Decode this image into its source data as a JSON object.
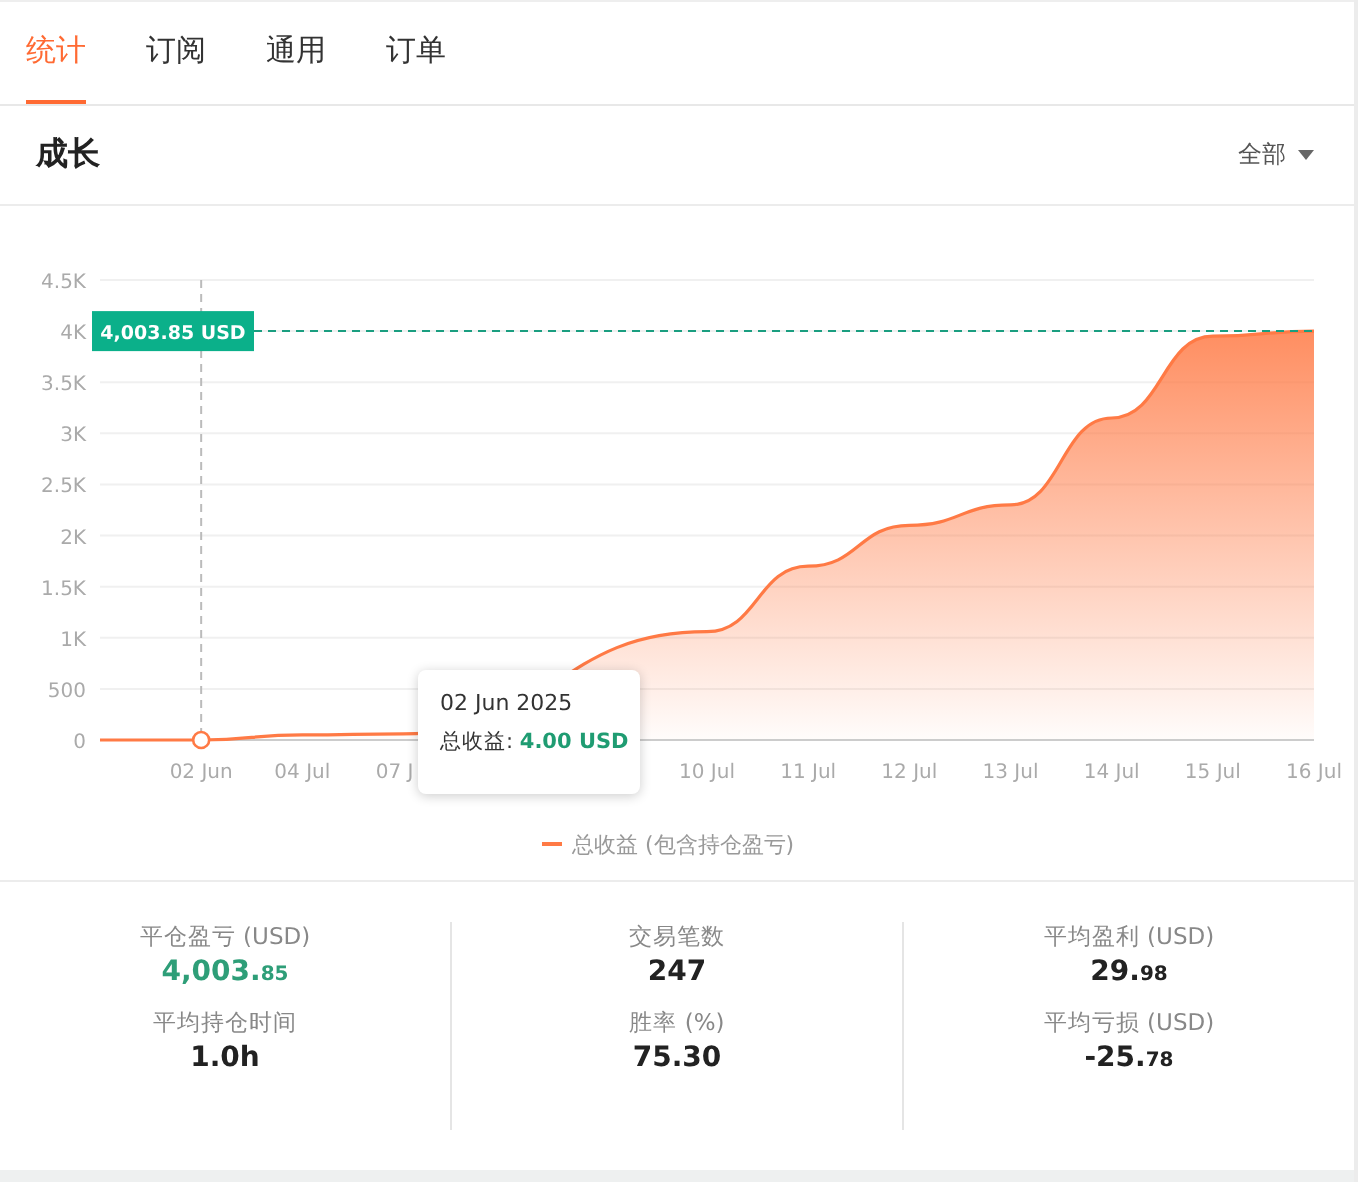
{
  "tabs": [
    {
      "label": "统计",
      "selected": true
    },
    {
      "label": "订阅",
      "selected": false
    },
    {
      "label": "通用",
      "selected": false
    },
    {
      "label": "订单",
      "selected": false
    }
  ],
  "growth": {
    "title": "成长",
    "filter": "全部",
    "tooltip": {
      "date": "02 Jun 2025",
      "text": "总收益: **4.00 USD**"
    },
    "chart_data": {
      "type": "area",
      "categories": [
        null,
        "02 Jun",
        "04 Jul",
        "07 J",
        null,
        null,
        "10 Jul",
        "11 Jul",
        "12 Jul",
        "13 Jul",
        "14 Jul",
        "15 Jul",
        "16 Jul"
      ],
      "ylim": [
        0,
        4500
      ],
      "yticks": [
        {
          "value": 0,
          "label": "0"
        },
        {
          "value": 500,
          "label": "500"
        },
        {
          "value": 1000,
          "label": "1K"
        },
        {
          "value": 1500,
          "label": "1.5K"
        },
        {
          "value": 2000,
          "label": "2K"
        },
        {
          "value": 2500,
          "label": "2.5K"
        },
        {
          "value": 3000,
          "label": "3K"
        },
        {
          "value": 3500,
          "label": "3.5K"
        },
        {
          "value": 4000,
          "label": "4K"
        },
        {
          "value": 4500,
          "label": "4.5K"
        }
      ],
      "series": [
        {
          "name": "总收益 (包含持仓盈亏)",
          "color": "#ff7a45",
          "values": [
            0,
            0,
            50,
            60,
            null,
            null,
            1060,
            1700,
            2100,
            2300,
            3150,
            3950,
            4000
          ]
        }
      ],
      "grid": true,
      "ref_lines": [
        {
          "axis": "y",
          "value": 4000,
          "label": "4,003.85 USD"
        },
        {
          "axis": "x",
          "value": "02 Jun"
        }
      ]
    }
  },
  "stats": [
    {
      "label": "平仓盈亏 (USD)",
      "whole": "4,003.",
      "fraction": "85",
      "highlighted": true
    },
    {
      "label": "交易笔数",
      "whole": "247",
      "highlighted": false
    },
    {
      "label": "平均盈利 (USD)",
      "whole": "29.",
      "fraction": "98",
      "highlighted": false
    },
    {
      "label": "平均持仓时间",
      "whole": "1.0h",
      "highlighted": false
    },
    {
      "label": "胜率 (%)",
      "whole": "75.30",
      "highlighted": false
    },
    {
      "label": "平均亏损 (USD)",
      "whole": "-25.",
      "fraction": "78",
      "highlighted": false
    }
  ]
}
